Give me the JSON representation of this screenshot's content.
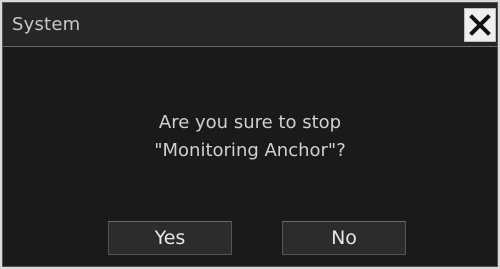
{
  "dialog": {
    "title": "System",
    "close_icon": "close-icon",
    "message_line1": "Are you sure to stop",
    "message_line2": "\"Monitoring Anchor\"?",
    "yes_label": "Yes",
    "no_label": "No"
  },
  "colors": {
    "background": "#1a1a1a",
    "titlebar": "#262626",
    "text": "#d0d0d0",
    "button": "#2c2c2c",
    "close_button": "#efefef"
  }
}
